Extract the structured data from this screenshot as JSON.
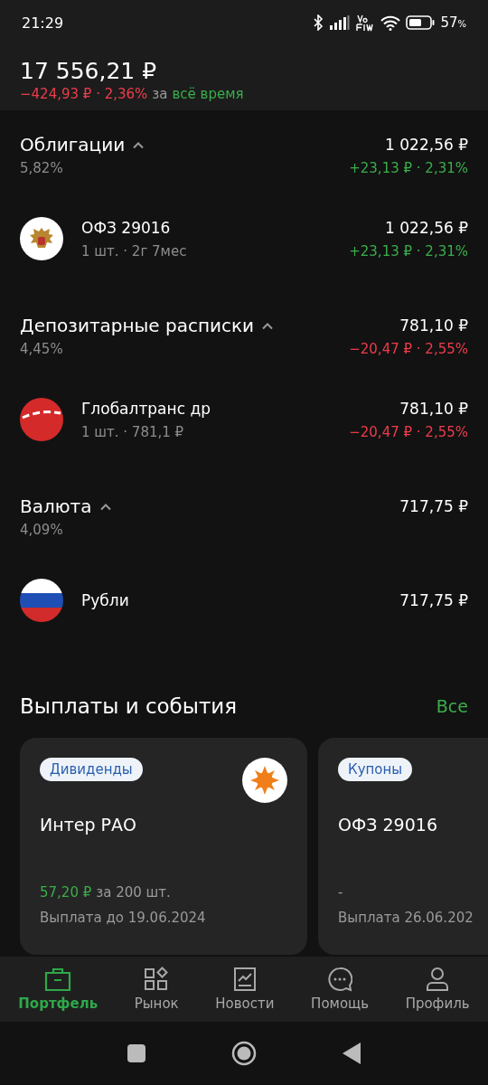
{
  "status_bar": {
    "time": "21:29",
    "battery": "57",
    "battery_unit": "%"
  },
  "header": {
    "total": "17 556,21 ₽",
    "change": {
      "text": "−424,93 ₽ · 2,36%",
      "kind": "loss"
    },
    "change_joiner": "за",
    "period": "всё время"
  },
  "groups": [
    {
      "title": "Облигации",
      "expanded": true,
      "share": "5,82%",
      "total": "1 022,56 ₽",
      "change": {
        "text": "+23,13 ₽ · 2,31%",
        "kind": "gain"
      },
      "items": [
        {
          "name": "ОФЗ 29016",
          "detail": "1 шт. · 2г 7мес",
          "value": "1 022,56 ₽",
          "change": {
            "text": "+23,13 ₽ · 2,31%",
            "kind": "gain"
          }
        }
      ]
    },
    {
      "title": "Депозитарные расписки",
      "expanded": true,
      "share": "4,45%",
      "total": "781,10 ₽",
      "change": {
        "text": "−20,47 ₽ · 2,55%",
        "kind": "loss"
      },
      "items": [
        {
          "name": "Глобалтранс др",
          "detail": "1 шт. · 781,1 ₽",
          "value": "781,10 ₽",
          "change": {
            "text": "−20,47 ₽ · 2,55%",
            "kind": "loss"
          }
        }
      ]
    },
    {
      "title": "Валюта",
      "expanded": true,
      "share": "4,09%",
      "total": "717,75 ₽",
      "items": [
        {
          "name": "Рубли",
          "value": "717,75 ₽"
        }
      ]
    }
  ],
  "events": {
    "title": "Выплаты и события",
    "all_link": "Все",
    "cards": [
      {
        "tag": "Дивиденды",
        "name": "Интер РАО",
        "amount": "57,20 ₽",
        "amount_suffix": "за 200 шт.",
        "date": "Выплата до 19.06.2024"
      },
      {
        "tag": "Купоны",
        "name": "ОФЗ 29016",
        "amount": "-",
        "date": "Выплата 26.06.202"
      }
    ]
  },
  "tabs": [
    {
      "label": "Портфель",
      "selected": true
    },
    {
      "label": "Рынок",
      "selected": false
    },
    {
      "label": "Новости",
      "selected": false
    },
    {
      "label": "Помощь",
      "selected": false
    },
    {
      "label": "Профиль",
      "selected": false
    }
  ]
}
